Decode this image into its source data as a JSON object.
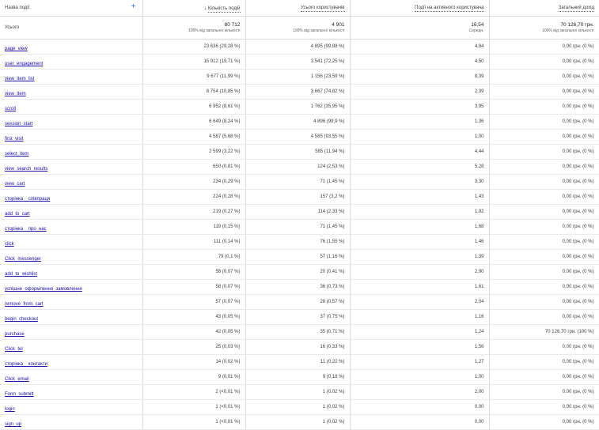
{
  "header": {
    "col_name": "Назва події",
    "col_event_count": "Кількість подій",
    "col_total_users": "Усього користувачів",
    "col_events_per_user": "Події на активного користувача",
    "col_total_revenue": "Загальний дохід",
    "sort_arrow": "↓",
    "add_icon": "+"
  },
  "totals": {
    "label": "Усього",
    "event_count": "80 712",
    "event_count_sub": "100% від загальної кількості",
    "total_users": "4 901",
    "total_users_sub": "100% від загальної кількості",
    "events_per_user": "16,54",
    "events_per_user_sub": "Середн.",
    "total_revenue": "70 126,70 грн.",
    "total_revenue_sub": "100% від загальної кількості"
  },
  "rows": [
    {
      "name": "page_view",
      "count": "23 636 (29,28 %)",
      "users": "4 895 (99,88 %)",
      "per_user": "4,84",
      "revenue": "0,00 грн. (0 %)"
    },
    {
      "name": "user_engagement",
      "count": "15 912 (19,71 %)",
      "users": "3 541 (72,25 %)",
      "per_user": "4,50",
      "revenue": "0,00 грн. (0 %)"
    },
    {
      "name": "view_item_list",
      "count": "9 677 (11,99 %)",
      "users": "1 156 (23,59 %)",
      "per_user": "8,39",
      "revenue": "0,00 грн. (0 %)"
    },
    {
      "name": "view_item",
      "count": "8 754 (10,85 %)",
      "users": "3 667 (74,82 %)",
      "per_user": "2,39",
      "revenue": "0,00 грн. (0 %)"
    },
    {
      "name": "scroll",
      "count": "6 952 (8,61 %)",
      "users": "1 762 (35,95 %)",
      "per_user": "3,95",
      "revenue": "0,00 грн. (0 %)"
    },
    {
      "name": "session_start",
      "count": "6 649 (8,24 %)",
      "users": "4 896 (99,9 %)",
      "per_user": "1,36",
      "revenue": "0,00 грн. (0 %)"
    },
    {
      "name": "first_visit",
      "count": "4 587 (5,68 %)",
      "users": "4 585 (93,55 %)",
      "per_user": "1,00",
      "revenue": "0,00 грн. (0 %)"
    },
    {
      "name": "select_item",
      "count": "2 599 (3,22 %)",
      "users": "585 (11,94 %)",
      "per_user": "4,44",
      "revenue": "0,00 грн. (0 %)"
    },
    {
      "name": "view_search_results",
      "count": "650 (0,81 %)",
      "users": "124 (2,53 %)",
      "per_user": "5,28",
      "revenue": "0,00 грн. (0 %)"
    },
    {
      "name": "view_cart",
      "count": "234 (0,29 %)",
      "users": "71 (1,45 %)",
      "per_user": "3,30",
      "revenue": "0,00 грн. (0 %)"
    },
    {
      "name": "сторінка__співпраця",
      "count": "224 (0,28 %)",
      "users": "157 (3,2 %)",
      "per_user": "1,43",
      "revenue": "0,00 грн. (0 %)"
    },
    {
      "name": "add_to_cart",
      "count": "219 (0,27 %)",
      "users": "114 (2,33 %)",
      "per_user": "1,92",
      "revenue": "0,00 грн. (0 %)"
    },
    {
      "name": "сторінка__про_нас",
      "count": "119 (0,15 %)",
      "users": "71 (1,45 %)",
      "per_user": "1,68",
      "revenue": "0,00 грн. (0 %)"
    },
    {
      "name": "click",
      "count": "111 (0,14 %)",
      "users": "76 (1,55 %)",
      "per_user": "1,46",
      "revenue": "0,00 грн. (0 %)"
    },
    {
      "name": "Click_messenger",
      "count": "79 (0,1 %)",
      "users": "57 (1,16 %)",
      "per_user": "1,39",
      "revenue": "0,00 грн. (0 %)"
    },
    {
      "name": "add_to_wishlist",
      "count": "58 (0,07 %)",
      "users": "20 (0,41 %)",
      "per_user": "2,90",
      "revenue": "0,00 грн. (0 %)"
    },
    {
      "name": "успішне_оформлення_замовлення",
      "count": "58 (0,07 %)",
      "users": "36 (0,73 %)",
      "per_user": "1,61",
      "revenue": "0,00 грн. (0 %)"
    },
    {
      "name": "remove_from_cart",
      "count": "57 (0,07 %)",
      "users": "28 (0,57 %)",
      "per_user": "2,04",
      "revenue": "0,00 грн. (0 %)"
    },
    {
      "name": "begin_checkout",
      "count": "43 (0,05 %)",
      "users": "37 (0,75 %)",
      "per_user": "1,16",
      "revenue": "0,00 грн. (0 %)"
    },
    {
      "name": "purchase",
      "count": "42 (0,05 %)",
      "users": "35 (0,71 %)",
      "per_user": "1,24",
      "revenue": "70 126,70 грн. (100 %)"
    },
    {
      "name": "Click_tel",
      "count": "25 (0,03 %)",
      "users": "16 (0,33 %)",
      "per_user": "1,56",
      "revenue": "0,00 грн. (0 %)"
    },
    {
      "name": "сторінка__контакти",
      "count": "14 (0,02 %)",
      "users": "11 (0,22 %)",
      "per_user": "1,27",
      "revenue": "0,00 грн. (0 %)"
    },
    {
      "name": "Click_email",
      "count": "9 (0,01 %)",
      "users": "9 (0,18 %)",
      "per_user": "1,00",
      "revenue": "0,00 грн. (0 %)"
    },
    {
      "name": "Form_submitt",
      "count": "2 (<0,01 %)",
      "users": "1 (0,02 %)",
      "per_user": "2,00",
      "revenue": "0,00 грн. (0 %)"
    },
    {
      "name": "login",
      "count": "1 (<0,01 %)",
      "users": "1 (0,02 %)",
      "per_user": "0,00",
      "revenue": "0,00 грн. (0 %)"
    },
    {
      "name": "sign_up",
      "count": "1 (<0,01 %)",
      "users": "1 (0,02 %)",
      "per_user": "0,00",
      "revenue": "0,00 грн. (0 %)"
    }
  ]
}
